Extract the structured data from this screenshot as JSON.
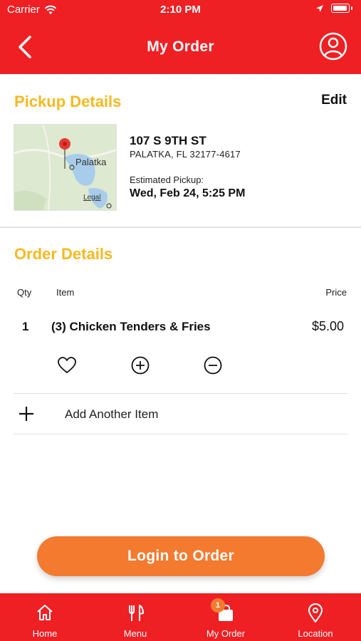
{
  "status_bar": {
    "carrier": "Carrier",
    "time": "2:10 PM"
  },
  "nav": {
    "title": "My Order"
  },
  "pickup": {
    "title": "Pickup Details",
    "edit_label": "Edit",
    "map": {
      "city_label": "Palatka",
      "legal_label": "Legal"
    },
    "address_line1": "107 S 9TH ST",
    "address_line2": "PALATKA, FL 32177-4617",
    "estimated_label": "Estimated Pickup:",
    "estimated_value": "Wed, Feb 24, 5:25 PM"
  },
  "order": {
    "title": "Order Details",
    "columns": {
      "qty": "Qty",
      "item": "Item",
      "price": "Price"
    },
    "items": [
      {
        "qty": "1",
        "name": "(3) Chicken Tenders & Fries",
        "price": "$5.00"
      }
    ],
    "add_item_label": "Add Another Item"
  },
  "login_button": "Login to Order",
  "tabs": [
    {
      "label": "Home",
      "icon": "home-icon"
    },
    {
      "label": "Menu",
      "icon": "fork-knife-icon"
    },
    {
      "label": "My Order",
      "icon": "shopping-bag-icon",
      "badge": "1"
    },
    {
      "label": "Location",
      "icon": "location-pin-icon"
    }
  ],
  "colors": {
    "brand_red": "#EE2024",
    "accent_yellow": "#F5B921",
    "button_orange": "#F47A30"
  }
}
